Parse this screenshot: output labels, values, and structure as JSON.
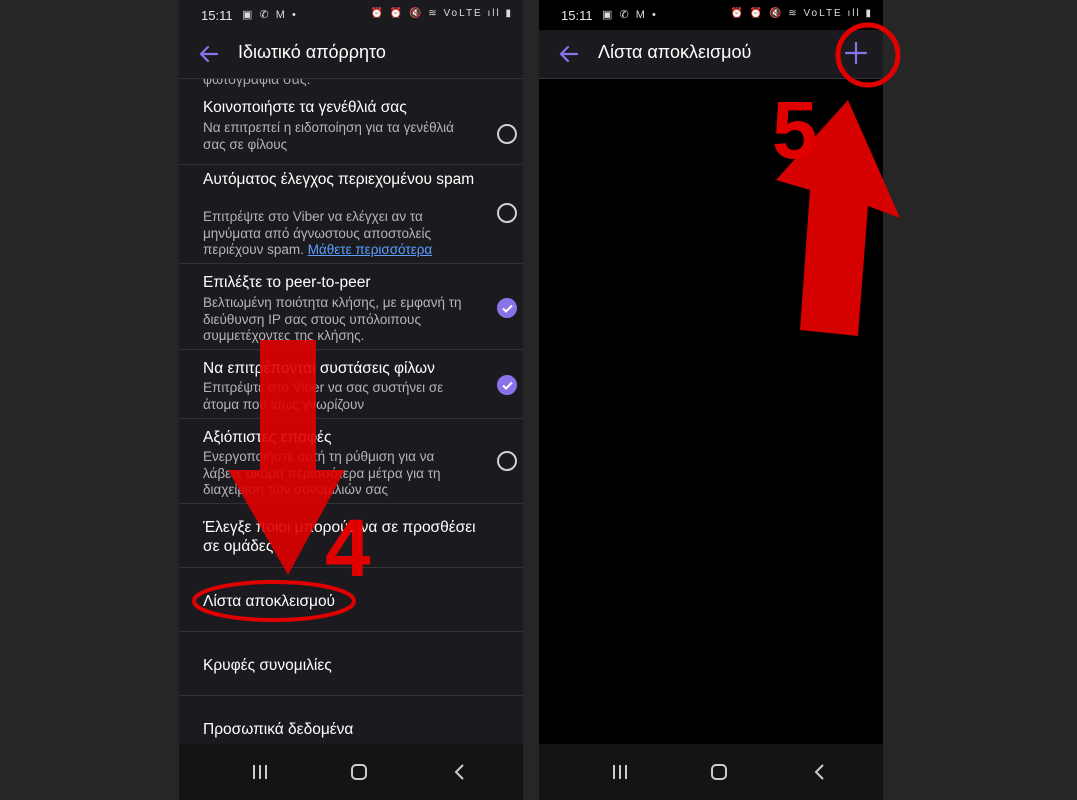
{
  "colors": {
    "accent": "#8a73e8",
    "annotation": "#e00000",
    "link": "#5aa0ff"
  },
  "left": {
    "status": {
      "time": "15:11",
      "notif_icons": "▣ ✆ M •",
      "sys_icons": "⏰ ⏰ 🔇 ≋ VoLTE ıll ▮"
    },
    "title": "Ιδιωτικό απόρρητο",
    "cutoff_text": "φωτογραφία σας.",
    "items": [
      {
        "title": "Κοινοποιήστε τα γενέθλιά σας",
        "desc": "Να επιτρεπεί η ειδοποίηση για τα γενέθλιά σας σε φίλους",
        "checked": false
      },
      {
        "title": "Αυτόματος έλεγχος περιεχομένου spam",
        "desc": "Επιτρέψτε στο Viber να ελέγχει αν τα μηνύματα από άγνωστους αποστολείς περιέχουν spam.",
        "link": "Μάθετε περισσότερα",
        "checked": false
      },
      {
        "title": "Επιλέξτε το peer-to-peer",
        "desc": "Βελτιωμένη ποιότητα κλήσης, με εμφανή τη διεύθυνση IP σας στους υπόλοιπους συμμετέχοντες της κλήσης.",
        "checked": true
      },
      {
        "title": "Να επιτρέπονται συστάσεις φίλων",
        "desc": "Επιτρέψτε στο Viber να σας συστήνει σε άτομα που ίσως γνωρίζουν",
        "checked": true
      },
      {
        "title": "Αξιόπιστες επαφές",
        "desc": "Ενεργοποιήστε αυτή τη ρύθμιση για να λάβετε ακόμα περισσότερα μέτρα για τη διαχείριση των συνομιλιών σας",
        "checked": false
      }
    ],
    "groups_item": "Έλεγξε ποιοι μπορούν να σε προσθέσει σε ομάδες",
    "blocklist_item": "Λίστα αποκλεισμού",
    "hidden_chats_item": "Κρυφές συνομιλίες",
    "personal_data_item": "Προσωπικά δεδομένα",
    "step_label": "4"
  },
  "right": {
    "status": {
      "time": "15:11",
      "notif_icons": "▣ ✆ M •",
      "sys_icons": "⏰ ⏰ 🔇 ≋ VoLTE ıll ▮"
    },
    "title": "Λίστα αποκλεισμού",
    "step_label": "5"
  }
}
